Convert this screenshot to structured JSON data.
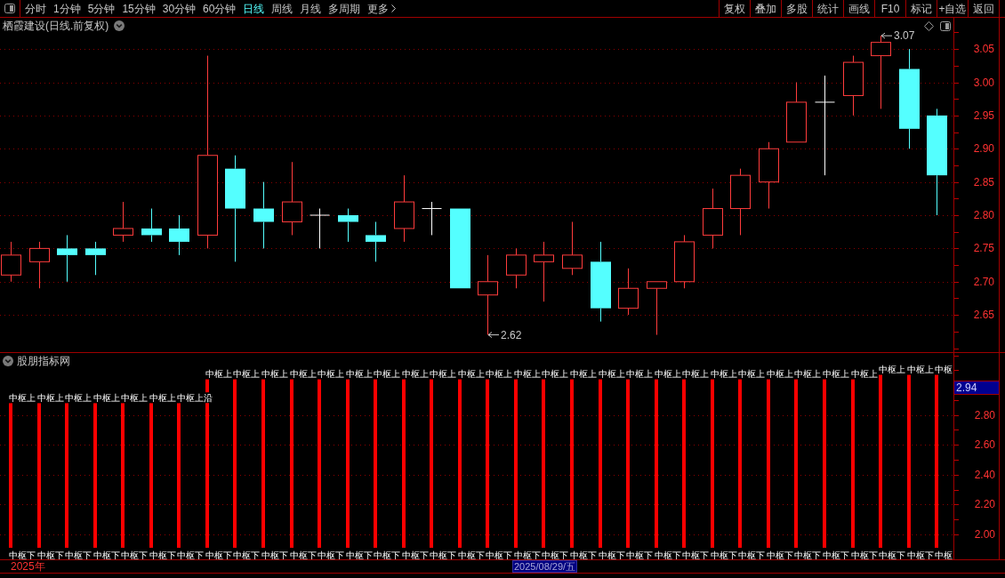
{
  "toolbar": {
    "periods": [
      {
        "label": "分时",
        "selected": false
      },
      {
        "label": "1分钟",
        "selected": false
      },
      {
        "label": "5分钟",
        "selected": false
      },
      {
        "label": "15分钟",
        "selected": false
      },
      {
        "label": "30分钟",
        "selected": false
      },
      {
        "label": "60分钟",
        "selected": false
      },
      {
        "label": "日线",
        "selected": true
      },
      {
        "label": "周线",
        "selected": false
      },
      {
        "label": "月线",
        "selected": false
      },
      {
        "label": "多周期",
        "selected": false
      }
    ],
    "more": "更多",
    "buttons": [
      "复权",
      "叠加",
      "多股",
      "统计",
      "画线",
      "F10",
      "标记",
      "+自选",
      "返回"
    ]
  },
  "main_chart": {
    "title": "栖霞建设(日线.前复权)",
    "markers": [
      {
        "kind": "high",
        "label": "3.07"
      },
      {
        "kind": "low",
        "label": "2.62"
      }
    ],
    "chart_data": [
      {
        "type": "candlestick",
        "categories": [
          null,
          null,
          null,
          null,
          null,
          null,
          null,
          null,
          null,
          null,
          null,
          null,
          null,
          null,
          null,
          null,
          null,
          null,
          null,
          null,
          null,
          null,
          null,
          null,
          null,
          null,
          null,
          null,
          null,
          null,
          null,
          null,
          null,
          null
        ],
        "ohlc": [
          [
            2.71,
            2.76,
            2.7,
            2.74
          ],
          [
            2.73,
            2.76,
            2.69,
            2.75
          ],
          [
            2.75,
            2.77,
            2.7,
            2.74
          ],
          [
            2.75,
            2.76,
            2.71,
            2.74
          ],
          [
            2.77,
            2.82,
            2.76,
            2.78
          ],
          [
            2.78,
            2.81,
            2.76,
            2.77
          ],
          [
            2.78,
            2.8,
            2.74,
            2.76
          ],
          [
            2.77,
            3.04,
            2.75,
            2.89
          ],
          [
            2.87,
            2.89,
            2.73,
            2.81
          ],
          [
            2.81,
            2.85,
            2.75,
            2.79
          ],
          [
            2.79,
            2.88,
            2.77,
            2.82
          ],
          [
            2.8,
            2.81,
            2.75,
            2.8
          ],
          [
            2.8,
            2.81,
            2.76,
            2.79
          ],
          [
            2.77,
            2.79,
            2.73,
            2.76
          ],
          [
            2.78,
            2.86,
            2.76,
            2.82
          ],
          [
            2.81,
            2.82,
            2.77,
            2.81
          ],
          [
            2.81,
            2.81,
            2.69,
            2.69
          ],
          [
            2.68,
            2.74,
            2.62,
            2.7
          ],
          [
            2.71,
            2.75,
            2.69,
            2.74
          ],
          [
            2.73,
            2.76,
            2.67,
            2.74
          ],
          [
            2.72,
            2.79,
            2.71,
            2.74
          ],
          [
            2.73,
            2.76,
            2.64,
            2.66
          ],
          [
            2.66,
            2.72,
            2.65,
            2.69
          ],
          [
            2.69,
            2.7,
            2.62,
            2.7
          ],
          [
            2.7,
            2.77,
            2.69,
            2.76
          ],
          [
            2.77,
            2.84,
            2.75,
            2.81
          ],
          [
            2.81,
            2.87,
            2.77,
            2.86
          ],
          [
            2.85,
            2.91,
            2.81,
            2.9
          ],
          [
            2.91,
            3.0,
            2.91,
            2.97
          ],
          [
            2.97,
            3.01,
            2.86,
            2.97
          ],
          [
            2.98,
            3.04,
            2.95,
            3.03
          ],
          [
            3.04,
            3.07,
            2.96,
            3.06
          ],
          [
            3.02,
            3.05,
            2.9,
            2.93
          ],
          [
            2.95,
            2.96,
            2.8,
            2.86
          ]
        ],
        "ylim": [
          2.594,
          3.097
        ],
        "yticks": [
          {
            "value": 3.05,
            "label": "3.05"
          },
          {
            "value": 3.0,
            "label": "3.00"
          },
          {
            "value": 2.95,
            "label": "2.95"
          },
          {
            "value": 2.9,
            "label": "2.90"
          },
          {
            "value": 2.85,
            "label": "2.85"
          },
          {
            "value": 2.8,
            "label": "2.80"
          },
          {
            "value": 2.75,
            "label": "2.75"
          },
          {
            "value": 2.7,
            "label": "2.70"
          },
          {
            "value": 2.65,
            "label": "2.65"
          }
        ],
        "grid": true
      }
    ]
  },
  "indicator": {
    "title": "股朋指标网",
    "value_label": "2.94",
    "top_labels": [
      "中枢上",
      "中枢上",
      "中枢上",
      "中枢上",
      "中枢上",
      "中枢上",
      "中枢上沿",
      "中枢上",
      "中枢上",
      "中枢上",
      "中枢上",
      "中枢上",
      "中枢上",
      "中枢上",
      "中枢上",
      "中枢上",
      "中枢上",
      "中枢上",
      "中枢上",
      "中枢上",
      "中枢上",
      "中枢上",
      "中枢上",
      "中枢上",
      "中枢上",
      "中枢上",
      "中枢上",
      "中枢上",
      "中枢上",
      "中枢上",
      "中枢上",
      "中枢上",
      "中枢上",
      "中枢"
    ],
    "bottom_labels": [
      "中枢下",
      "中枢下",
      "中枢下",
      "中枢下",
      "中枢下",
      "中枢下",
      "中枢下",
      "中枢下",
      "中枢下",
      "中枢下",
      "中枢下",
      "中枢下",
      "中枢下",
      "中枢下",
      "中枢下",
      "中枢下",
      "中枢下",
      "中枢下",
      "中枢下",
      "中枢下",
      "中枢下",
      "中枢下",
      "中枢下",
      "中枢下",
      "中枢下",
      "中枢下",
      "中枢下",
      "中枢下",
      "中枢下",
      "中枢下",
      "中枢下",
      "中枢下",
      "中枢下",
      "中枢"
    ],
    "chart_data": [
      {
        "type": "bar",
        "categories": [
          null,
          null,
          null,
          null,
          null,
          null,
          null,
          null,
          null,
          null,
          null,
          null,
          null,
          null,
          null,
          null,
          null,
          null,
          null,
          null,
          null,
          null,
          null,
          null,
          null,
          null,
          null,
          null,
          null,
          null,
          null,
          null,
          null,
          null
        ],
        "values": [
          2.88,
          2.88,
          2.88,
          2.88,
          2.88,
          2.88,
          2.88,
          3.04,
          3.04,
          3.04,
          3.04,
          3.04,
          3.04,
          3.04,
          3.04,
          3.04,
          3.04,
          3.04,
          3.04,
          3.04,
          3.04,
          3.04,
          3.04,
          3.04,
          3.04,
          3.04,
          3.04,
          3.04,
          3.04,
          3.04,
          3.04,
          3.07,
          3.07,
          3.07
        ],
        "color": "#ff0000",
        "ylim": [
          1.91,
          3.215
        ],
        "yticks": [
          {
            "value": 2.8,
            "label": "2.80"
          },
          {
            "value": 2.6,
            "label": "2.60"
          },
          {
            "value": 2.4,
            "label": "2.40"
          },
          {
            "value": 2.2,
            "label": "2.20"
          },
          {
            "value": 2.0,
            "label": "2.00"
          }
        ],
        "grid": true
      }
    ]
  },
  "time_axis": {
    "year": "2025年",
    "cursor_date": "2025/08/29/五"
  }
}
